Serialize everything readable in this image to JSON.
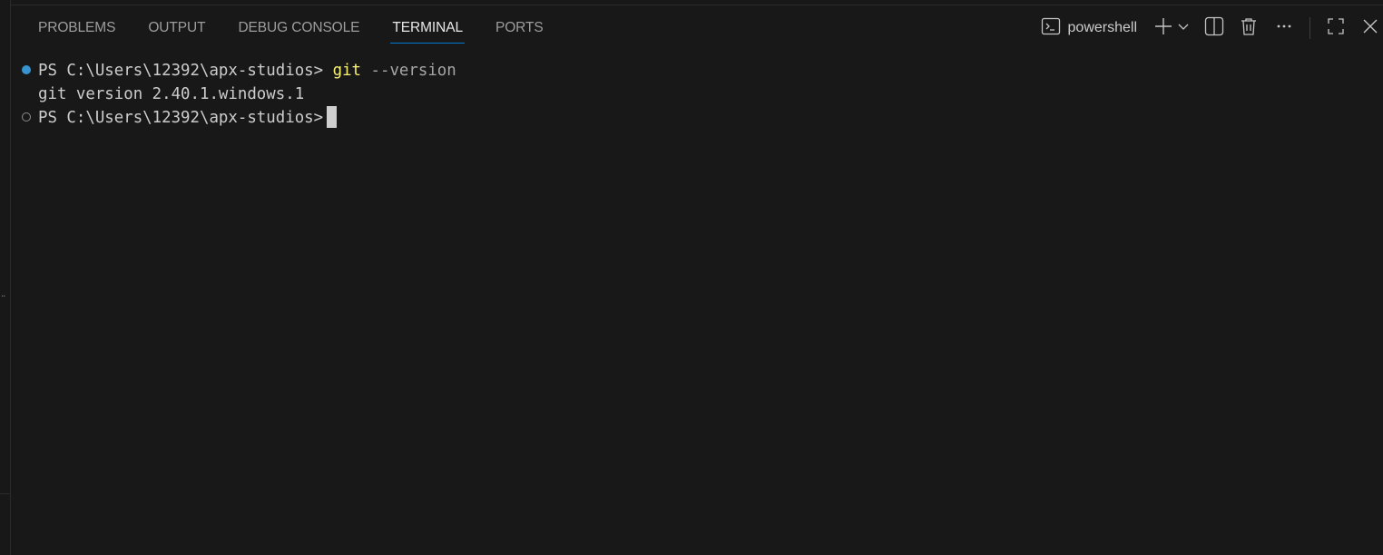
{
  "panel": {
    "tabs": [
      {
        "label": "PROBLEMS"
      },
      {
        "label": "OUTPUT"
      },
      {
        "label": "DEBUG CONSOLE"
      },
      {
        "label": "TERMINAL"
      },
      {
        "label": "PORTS"
      }
    ],
    "active_tab": "TERMINAL",
    "terminal_name": "powershell",
    "accent_color": "#0078d4"
  },
  "terminal": {
    "prompt": "PS C:\\Users\\12392\\apx-studios>",
    "command": "git",
    "command_arg": "--version",
    "output": "git version 2.40.1.windows.1",
    "colors": {
      "command": "#f9f171",
      "success_decoration": "#3794d0",
      "background": "#181818"
    }
  },
  "icons": {
    "terminal": "terminal-icon",
    "add": "plus-icon",
    "dropdown": "chevron-down-icon",
    "split": "split-terminal-icon",
    "kill": "trash-icon",
    "more": "ellipsis-icon",
    "maximize": "maximize-icon",
    "close": "close-icon"
  }
}
